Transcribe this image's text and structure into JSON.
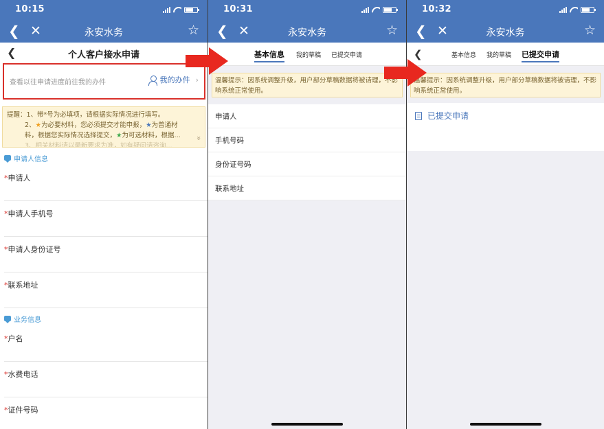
{
  "screen1": {
    "status": {
      "time": "10:15"
    },
    "nav": {
      "back": "❮",
      "close": "✕",
      "title": "永安水务",
      "star": "☆"
    },
    "page": {
      "back": "❮",
      "title": "个人客户接水申请"
    },
    "progress": {
      "hint": "查看以往申请进度前往我的办件",
      "my_items_label": "我的办件",
      "chevron": "›"
    },
    "notice": {
      "line1": "提醒：1、带*号为必填项，请根据实际情况进行填写。",
      "line2_a": "2、",
      "line2_star": "★",
      "line2_b": "为必要材料，您必须提交才能申报，",
      "line2_star2": "★",
      "line2_c": "为普通材",
      "line3_a": "料，根据您实际情况选择提交，",
      "line3_star": "★",
      "line3_b": "为可选材料，根据...",
      "line4": "3、相关材料请以最新要求为准，如有疑问请咨询...",
      "expand": "»"
    },
    "section1": "申请人信息",
    "fields1": [
      "申请人",
      "申请人手机号",
      "申请人身份证号",
      "联系地址"
    ],
    "section2": "业务信息",
    "fields2": [
      "户名",
      "水费电话",
      "证件号码"
    ],
    "required_mark": "*"
  },
  "screen2": {
    "status": {
      "time": "10:31"
    },
    "nav": {
      "back": "❮",
      "close": "✕",
      "title": "永安水务",
      "star": "☆"
    },
    "tabs": [
      "基本信息",
      "我的草稿",
      "已提交申请"
    ],
    "active_tab": 0,
    "notice": "温馨提示：因系统调整升级，用户部分草稿数据将被请理，不影响系统正常使用。",
    "items": [
      "申请人",
      "手机号码",
      "身份证号码",
      "联系地址"
    ]
  },
  "screen3": {
    "status": {
      "time": "10:32"
    },
    "nav": {
      "back": "❮",
      "close": "✕",
      "title": "永安水务",
      "star": "☆"
    },
    "tabs_back": "❮",
    "tabs": [
      "基本信息",
      "我的草稿",
      "已提交申请"
    ],
    "active_tab": 2,
    "notice": "温馨提示：因系统调整升级，用户部分草稿数据将被请理，不影响系统正常使用。",
    "submitted_label": "已提交申请"
  },
  "colors": {
    "brand": "#4a77bb",
    "highlight_box": "#d9302a",
    "arrow": "#e8281f",
    "notice_bg": "#fdf4d8"
  },
  "icons": [
    "back-icon",
    "close-icon",
    "star-icon",
    "person-icon",
    "chevron-right-icon",
    "chat-bubble-icon",
    "document-icon",
    "arrow-right-icon"
  ]
}
